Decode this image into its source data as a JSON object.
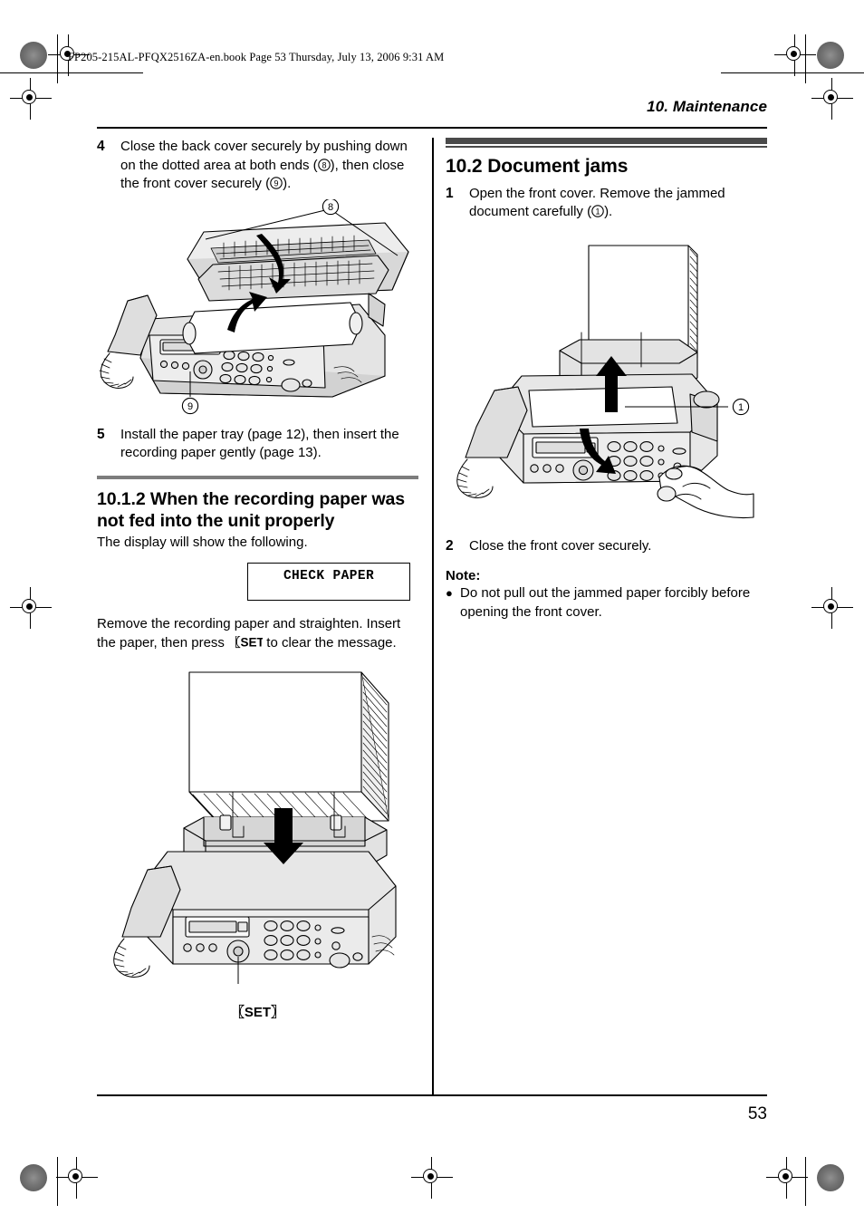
{
  "print_marks": {
    "book_header": "FP205-215AL-PFQX2516ZA-en.book  Page 53  Thursday, July 13, 2006  9:31 AM"
  },
  "running_head": {
    "chapter": "10. Maintenance"
  },
  "left_column": {
    "step4": {
      "number": "4",
      "text": "Close the back cover securely by pushing down on the dotted area at both ends (⓪), then close the front cover securely (⓪)."
    },
    "step4_parts": {
      "lead": "Close the back cover securely by pushing down on the dotted area at both ends (",
      "ref_a": "8",
      "mid": "), then close the front cover securely (",
      "ref_b": "9",
      "tail": ")."
    },
    "figure1": {
      "name": "fax-machine-back-cover-closing",
      "callout_top": "8",
      "callout_bottom": "9"
    },
    "step5": {
      "number": "5",
      "text": "Install the paper tray (page 12), then insert the recording paper gently (page 13)."
    },
    "section_10_1_2": {
      "heading": "10.1.2 When the recording paper was not fed into the unit properly",
      "intro": "The display will show the following.",
      "display_message": "CHECK PAPER",
      "after_parts": {
        "lead": "Remove the recording paper and straighten. Insert the paper, then press ",
        "key": "{SET}",
        "tail": " to clear the message."
      }
    },
    "figure2": {
      "name": "fax-machine-paper-insert",
      "caption": "{SET}"
    }
  },
  "right_column": {
    "section_10_2": {
      "heading": "10.2 Document jams"
    },
    "step1": {
      "number": "1",
      "parts": {
        "lead": "Open the front cover. Remove the jammed document carefully (",
        "ref": "1",
        "tail": ")."
      }
    },
    "figure3": {
      "name": "fax-machine-document-jam",
      "callout": "1"
    },
    "step2": {
      "number": "2",
      "text": "Close the front cover securely."
    },
    "note": {
      "title": "Note:",
      "bullet": "●",
      "items": [
        "Do not pull out the jammed paper forcibly before opening the front cover."
      ]
    }
  },
  "footer": {
    "page_number": "53"
  },
  "colors": {
    "rule_gray": "#7d7d7d",
    "rule_dark": "#4a4a4a",
    "text": "#000000",
    "art_light": "#e8e8e8",
    "art_mid": "#c9c9c9",
    "art_dark": "#9a9a9a"
  }
}
